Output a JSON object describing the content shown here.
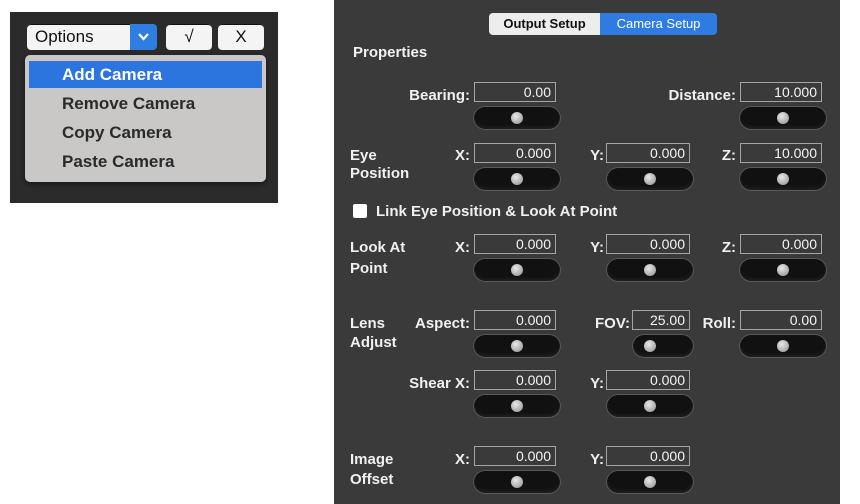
{
  "options_menu": {
    "select_label": "Options",
    "check_label": "√",
    "close_label": "X",
    "items": [
      "Add Camera",
      "Remove Camera",
      "Copy Camera",
      "Paste Camera"
    ],
    "selected_index": 0,
    "accent_color": "#2c74de"
  },
  "camera_panel": {
    "tabs": [
      "Output Setup",
      "Camera Setup"
    ],
    "active_tab": "Camera Setup",
    "properties_title": "Properties",
    "bearing": {
      "label": "Bearing:",
      "value": "0.00"
    },
    "distance": {
      "label": "Distance:",
      "value": "10.000"
    },
    "eye_position": {
      "label_line1": "Eye",
      "label_line2": "Position",
      "x": {
        "label": "X:",
        "value": "0.000"
      },
      "y": {
        "label": "Y:",
        "value": "0.000"
      },
      "z": {
        "label": "Z:",
        "value": "10.000"
      }
    },
    "link_checkbox": {
      "label": "Link Eye Position & Look At Point",
      "checked": false
    },
    "look_at": {
      "label_line1": "Look At",
      "label_line2": "Point",
      "x": {
        "label": "X:",
        "value": "0.000"
      },
      "y": {
        "label": "Y:",
        "value": "0.000"
      },
      "z": {
        "label": "Z:",
        "value": "0.000"
      }
    },
    "lens_adjust": {
      "label_line1": "Lens",
      "label_line2": "Adjust",
      "aspect": {
        "label": "Aspect:",
        "value": "0.000"
      },
      "fov": {
        "label": "FOV:",
        "value": "25.00"
      },
      "roll": {
        "label": "Roll:",
        "value": "0.00"
      },
      "shear_x": {
        "label": "Shear X:",
        "value": "0.000"
      },
      "shear_y": {
        "label": "Y:",
        "value": "0.000"
      }
    },
    "image_offset": {
      "label_line1": "Image",
      "label_line2": "Offset",
      "x": {
        "label": "X:",
        "value": "0.000"
      },
      "y": {
        "label": "Y:",
        "value": "0.000"
      }
    }
  }
}
